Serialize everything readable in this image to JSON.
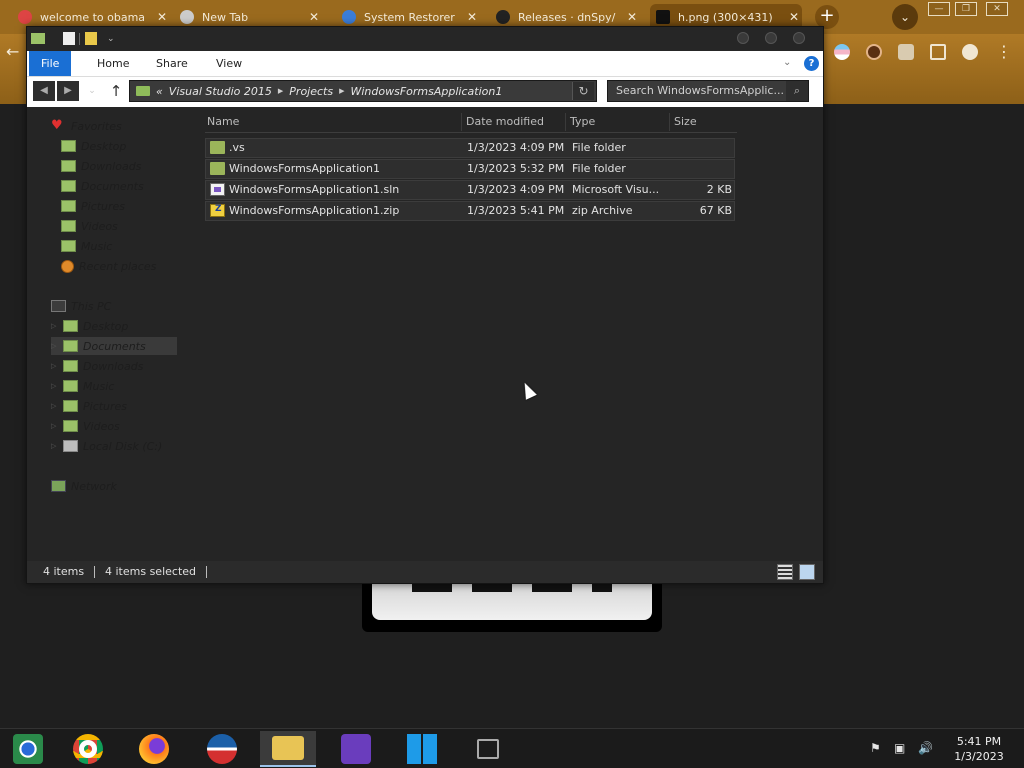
{
  "browser": {
    "tabs": [
      {
        "title": "welcome to obama",
        "active": false
      },
      {
        "title": "New Tab",
        "active": false
      },
      {
        "title": "System Restorer",
        "active": false
      },
      {
        "title": "Releases · dnSpy/",
        "active": false
      },
      {
        "title": "h.png (300×431)",
        "active": true
      }
    ],
    "new_tab": "+",
    "profile_dropdown": "⌄",
    "window_minimize": "—",
    "window_restore": "❐",
    "window_close": "✕",
    "back": "←",
    "menu": "⋮"
  },
  "explorer": {
    "ribbon_tabs": [
      "File",
      "Home",
      "Share",
      "View"
    ],
    "help": "?",
    "address": {
      "prefix": "«",
      "crumbs": [
        "Visual Studio 2015",
        "Projects",
        "WindowsFormsApplication1"
      ]
    },
    "search_placeholder": "Search WindowsFormsApplic...",
    "nav_pane": {
      "favorites_header": "Favorites",
      "favorites": [
        "Desktop",
        "Downloads",
        "Documents",
        "Pictures",
        "Videos",
        "Music",
        "Recent places"
      ],
      "this_pc_header": "This PC",
      "this_pc": [
        "Desktop",
        "Documents",
        "Downloads",
        "Music",
        "Pictures",
        "Videos",
        "Local Disk (C:)"
      ],
      "selected": "Documents",
      "network": "Network"
    },
    "columns": [
      "Name",
      "Date modified",
      "Type",
      "Size"
    ],
    "files": [
      {
        "name": ".vs",
        "date": "1/3/2023 4:09 PM",
        "type": "File folder",
        "size": "",
        "icon": "folder-icon"
      },
      {
        "name": "WindowsFormsApplication1",
        "date": "1/3/2023 5:32 PM",
        "type": "File folder",
        "size": "",
        "icon": "folder-icon"
      },
      {
        "name": "WindowsFormsApplication1.sln",
        "date": "1/3/2023 4:09 PM",
        "type": "Microsoft Visu...",
        "size": "2 KB",
        "icon": "solution-file-icon"
      },
      {
        "name": "WindowsFormsApplication1.zip",
        "date": "1/3/2023 5:41 PM",
        "type": "zip Archive",
        "size": "67 KB",
        "icon": "zip-file-icon"
      }
    ],
    "status": {
      "items": "4 items",
      "selected": "4 items selected"
    }
  },
  "taskbar": {
    "apps": [
      "Chromium",
      "Google Chrome",
      "Firefox",
      "Obama",
      "File Explorer",
      "Visual Studio",
      "Windows",
      "Task View"
    ],
    "active_app": "File Explorer",
    "clock_time": "5:41 PM",
    "clock_date": "1/3/2023"
  },
  "colors": {
    "accent": "#1a6fd4",
    "browser_frame": "#9a6a1e",
    "explorer_bg": "#252525",
    "taskbar_bg": "#1b1b1b"
  }
}
